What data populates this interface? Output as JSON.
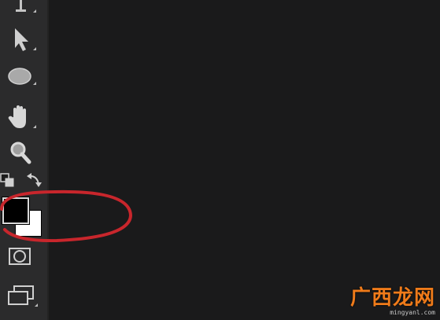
{
  "toolbar": {
    "tools": [
      {
        "id": "type-tool",
        "icon": "type-cursor-icon"
      },
      {
        "id": "path-selection-tool",
        "icon": "arrow-cursor-icon"
      },
      {
        "id": "ellipse-tool",
        "icon": "ellipse-icon"
      },
      {
        "id": "hand-tool",
        "icon": "hand-icon"
      },
      {
        "id": "zoom-tool",
        "icon": "magnifier-icon"
      },
      {
        "id": "default-colors",
        "icon": "default-colors-icon"
      },
      {
        "id": "swap-colors",
        "icon": "swap-arrow-icon"
      },
      {
        "id": "quick-mask",
        "icon": "quick-mask-icon"
      },
      {
        "id": "screen-mode",
        "icon": "screen-mode-icon"
      }
    ],
    "foreground_color": "#000000",
    "background_color": "#ffffff"
  },
  "annotation": {
    "color": "#c8262c",
    "shape": "ellipse"
  },
  "watermark": {
    "title": "广西龙网",
    "subtitle": "mingyanl.com",
    "color": "#ef7b1a"
  }
}
